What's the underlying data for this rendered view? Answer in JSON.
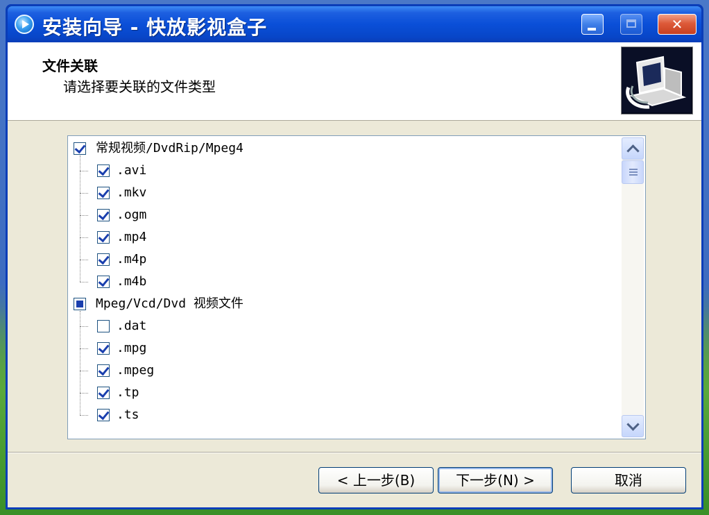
{
  "window": {
    "title": "安装向导 - 快放影视盒子"
  },
  "header": {
    "title": "文件关联",
    "subtitle": "请选择要关联的文件类型",
    "logo_icon": "installer-computer-icon"
  },
  "tree": {
    "groups": [
      {
        "label": "常规视频/DvdRip/Mpeg4",
        "state": "checked",
        "items": [
          {
            "label": ".avi",
            "checked": true
          },
          {
            "label": ".mkv",
            "checked": true
          },
          {
            "label": ".ogm",
            "checked": true
          },
          {
            "label": ".mp4",
            "checked": true
          },
          {
            "label": ".m4p",
            "checked": true
          },
          {
            "label": ".m4b",
            "checked": true
          }
        ]
      },
      {
        "label": "Mpeg/Vcd/Dvd 视频文件",
        "state": "partial",
        "items": [
          {
            "label": ".dat",
            "checked": false
          },
          {
            "label": ".mpg",
            "checked": true
          },
          {
            "label": ".mpeg",
            "checked": true
          },
          {
            "label": ".tp",
            "checked": true
          },
          {
            "label": ".ts",
            "checked": true
          }
        ]
      }
    ]
  },
  "buttons": {
    "back": "< 上一步(B)",
    "next": "下一步(N) >",
    "cancel": "取消"
  },
  "colors": {
    "titlebar": "#0a4fd8",
    "client_bg": "#ece9d8",
    "check": "#1a3fae"
  }
}
